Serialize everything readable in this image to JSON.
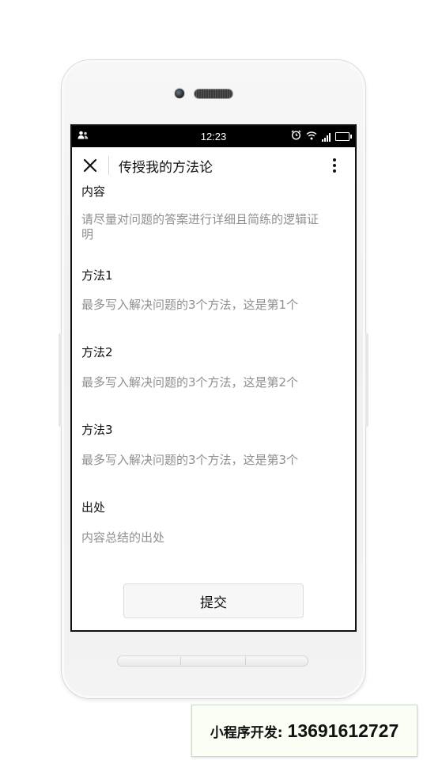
{
  "status_bar": {
    "time": "12:23",
    "icons": [
      "contacts-icon",
      "alarm-icon",
      "wifi-icon",
      "signal-icon",
      "battery-icon"
    ]
  },
  "navbar": {
    "close_icon": "close-icon",
    "title": "传授我的方法论",
    "more_icon": "more-vertical-icon"
  },
  "form": {
    "content": {
      "label": "内容",
      "placeholder": "请尽量对问题的答案进行详细且简练的逻辑证明"
    },
    "method1": {
      "label": "方法1",
      "placeholder": "最多写入解决问题的3个方法，这是第1个"
    },
    "method2": {
      "label": "方法2",
      "placeholder": "最多写入解决问题的3个方法，这是第2个"
    },
    "method3": {
      "label": "方法3",
      "placeholder": "最多写入解决问题的3个方法，这是第3个"
    },
    "source": {
      "label": "出处",
      "placeholder": "内容总结的出处"
    },
    "submit_label": "提交"
  },
  "watermark": {
    "label": "小程序开发:",
    "phone": "13691612727"
  }
}
